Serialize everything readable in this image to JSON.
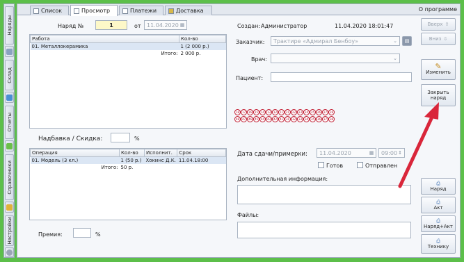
{
  "sidebar": {
    "items": [
      {
        "label": "Наряды",
        "icon": "orders-icon"
      },
      {
        "label": "Склад",
        "icon": "warehouse-icon"
      },
      {
        "label": "Отчеты",
        "icon": "reports-icon"
      },
      {
        "label": "Справочники",
        "icon": "directories-icon"
      },
      {
        "label": "Настройки",
        "icon": "settings-icon"
      }
    ]
  },
  "tabs": [
    {
      "label": "Список"
    },
    {
      "label": "Просмотр"
    },
    {
      "label": "Платежи"
    },
    {
      "label": "Доставка"
    }
  ],
  "about_label": "О программе",
  "order": {
    "number_label": "Наряд №",
    "number_value": "1",
    "from_label": "от",
    "date_value": "11.04.2020"
  },
  "works_table": {
    "headers": [
      "Работа",
      "Кол-во"
    ],
    "rows": [
      [
        "01. Металлокерамика",
        "1 (2 000 р.)"
      ]
    ],
    "total_label": "Итого:",
    "total_value": "2 000 р."
  },
  "surcharge": {
    "label": "Надбавка / Скидка:",
    "value": "",
    "unit": "%"
  },
  "ops_table": {
    "headers": [
      "Операция",
      "Кол-во",
      "Исполнит.",
      "Срок"
    ],
    "rows": [
      [
        "01. Модель (3 кл.)",
        "1 (50 р.)",
        "Хокинс Д.К.",
        "11.04.18:00"
      ]
    ],
    "total_label": "Итого:",
    "total_value": "50 р."
  },
  "premium": {
    "label": "Премия:",
    "value": "",
    "unit": "%"
  },
  "created": {
    "label": "Создан:",
    "author": "Администратор",
    "datetime": "11.04.2020 18:01:47"
  },
  "customer": {
    "label": "Заказчик:",
    "value": "Трактире «Адмирал Бенбоу»"
  },
  "doctor": {
    "label": "Врач:",
    "value": ""
  },
  "patient": {
    "label": "Пациент:",
    "value": ""
  },
  "teeth_upper": [
    "18",
    "17",
    "16",
    "15",
    "14",
    "13",
    "12",
    "11",
    "21",
    "22",
    "23",
    "24",
    "25",
    "26",
    "27",
    "28"
  ],
  "teeth_lower": [
    "48",
    "47",
    "46",
    "45",
    "44",
    "43",
    "42",
    "41",
    "31",
    "32",
    "33",
    "34",
    "35",
    "36",
    "37",
    "38"
  ],
  "delivery": {
    "label": "Дата сдачи/примерки:",
    "date": "11.04.2020",
    "time": "09:00",
    "ready_label": "Готов",
    "sent_label": "Отправлен"
  },
  "extra_info": {
    "label": "Дополнительная информация:",
    "value": ""
  },
  "files": {
    "label": "Файлы:",
    "value": ""
  },
  "right_buttons": {
    "up": "Вверх",
    "down": "Вниз",
    "edit": "Изменить",
    "close_order": "Закрыть наряд",
    "print_order": "Наряд",
    "print_act": "Акт",
    "print_order_act": "Наряд+Акт",
    "print_tech": "Технику"
  },
  "colors": {
    "frame": "#5cbf4a",
    "arrow": "#d9263a",
    "highlight": "#fdf8c8"
  }
}
